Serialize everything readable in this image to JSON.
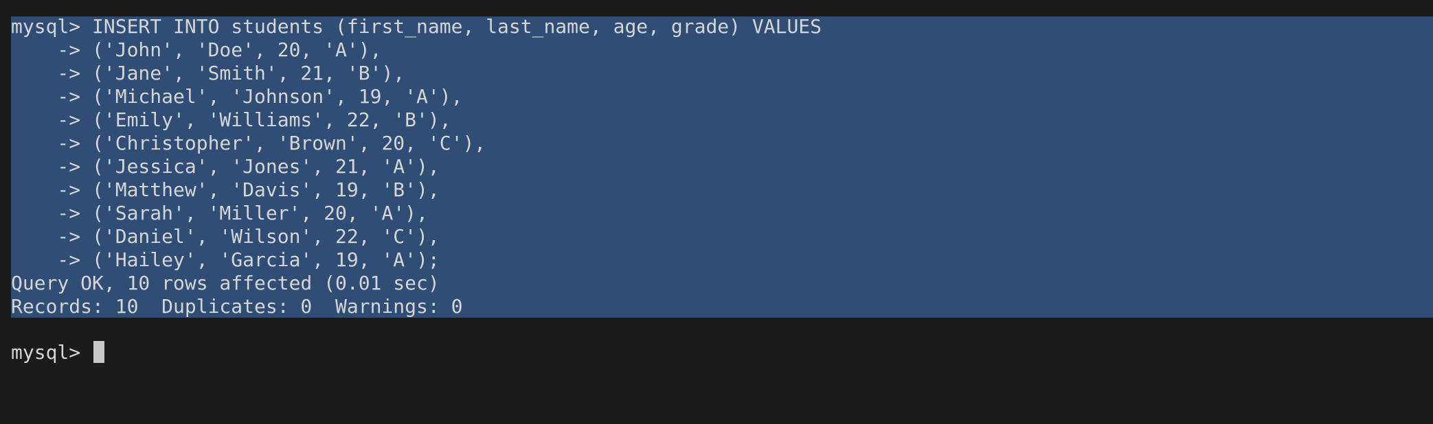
{
  "terminal": {
    "lines": [
      "mysql> INSERT INTO students (first_name, last_name, age, grade) VALUES",
      "    -> ('John', 'Doe', 20, 'A'),",
      "    -> ('Jane', 'Smith', 21, 'B'),",
      "    -> ('Michael', 'Johnson', 19, 'A'),",
      "    -> ('Emily', 'Williams', 22, 'B'),",
      "    -> ('Christopher', 'Brown', 20, 'C'),",
      "    -> ('Jessica', 'Jones', 21, 'A'),",
      "    -> ('Matthew', 'Davis', 19, 'B'),",
      "    -> ('Sarah', 'Miller', 20, 'A'),",
      "    -> ('Daniel', 'Wilson', 22, 'C'),",
      "    -> ('Hailey', 'Garcia', 19, 'A');",
      "Query OK, 10 rows affected (0.01 sec)",
      "Records: 10  Duplicates: 0  Warnings: 0"
    ],
    "prompt": "mysql> "
  },
  "colors": {
    "background": "#1b1b1b",
    "selection": "#2f4d75",
    "text": "#d6d6d6",
    "cursor": "#c8c8c8"
  }
}
